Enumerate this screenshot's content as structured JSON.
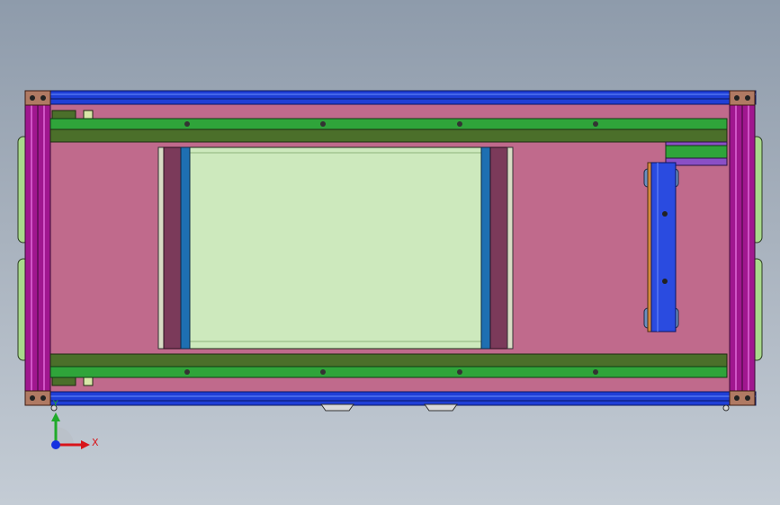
{
  "viewport": {
    "background_top": "#8e9bab",
    "background_bottom": "#c4ccd5"
  },
  "colors": {
    "frame_magenta": "#a0178f",
    "rail_blue": "#1f3fd6",
    "plate_pink": "#c06a8c",
    "guide_green": "#2fa43a",
    "guide_dark_green": "#4b6f2a",
    "belt_light_green": "#cde9bd",
    "roller_maroon": "#7b3a5a",
    "roller_blue": "#1e6fb2",
    "cylinder_blue": "#2a4be0",
    "foot_green": "#a9d98c",
    "corner_brown": "#b07a63"
  },
  "icons": {
    "triad": "coordinate-triad-icon"
  },
  "triad": {
    "x_label": "X",
    "y_label": "Y"
  }
}
